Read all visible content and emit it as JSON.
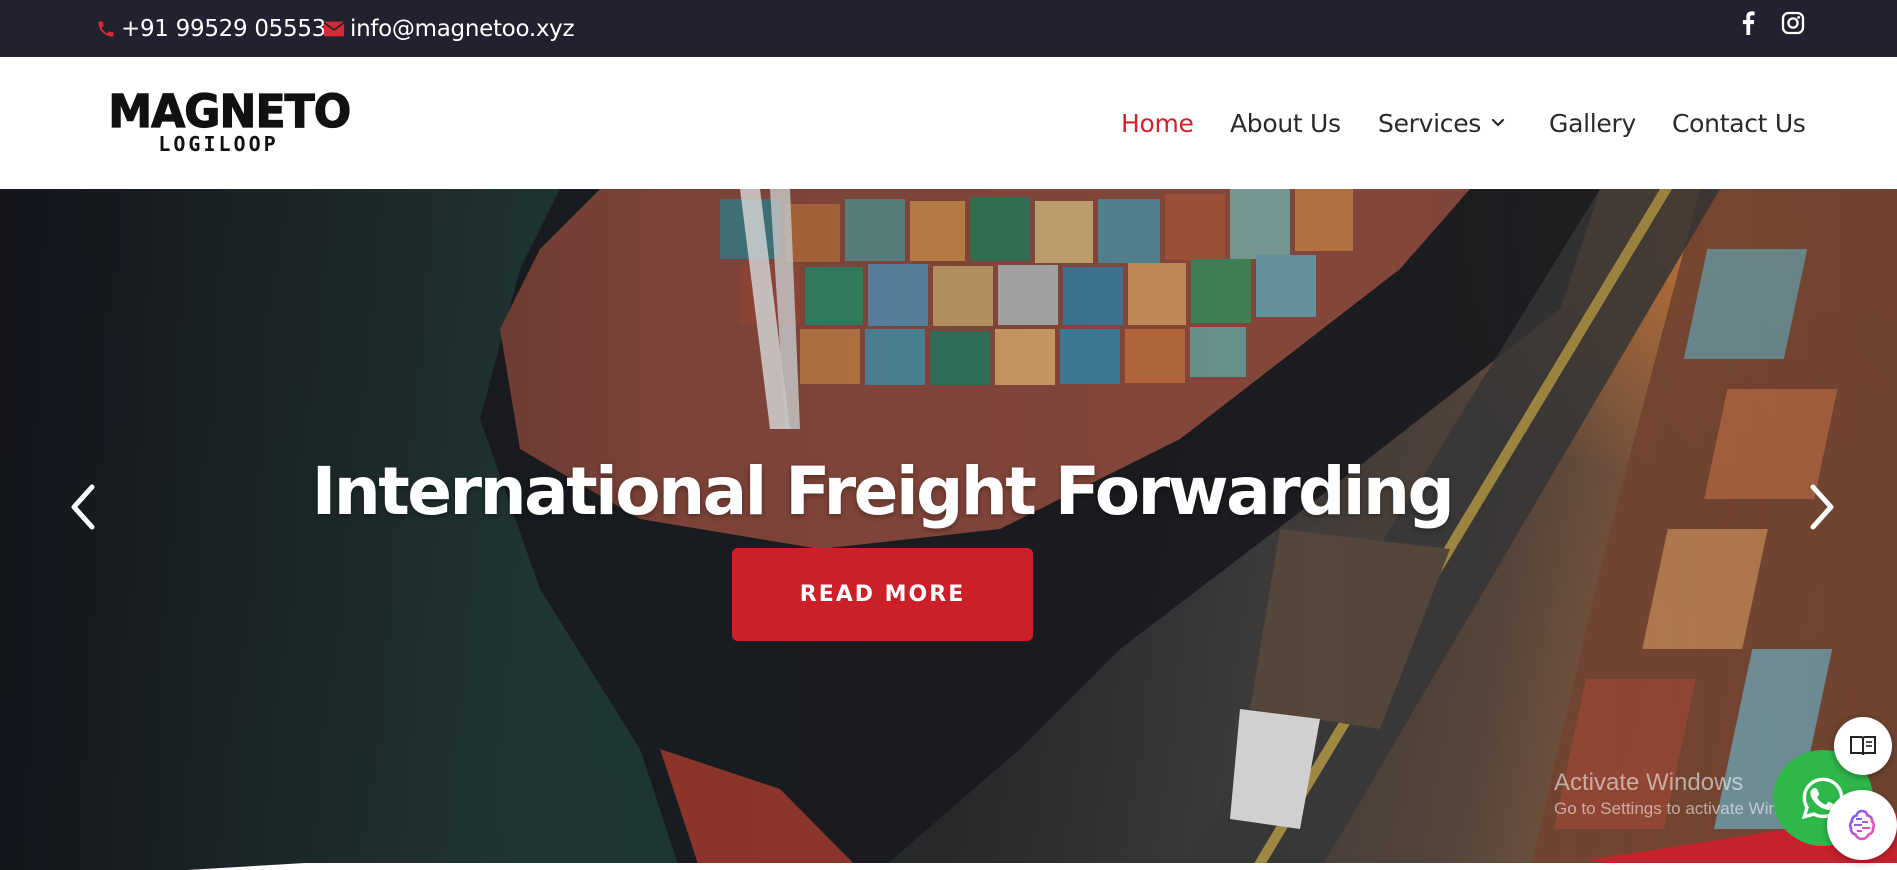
{
  "topbar": {
    "phone": "+91 99529 05553",
    "email": "info@magnetoo.xyz",
    "phone_icon": "phone-icon",
    "email_icon": "envelope-icon",
    "social": [
      "facebook-icon",
      "instagram-icon"
    ]
  },
  "header": {
    "logo": {
      "brand": "MAGNETO",
      "sub": "LOGILOOP"
    },
    "nav": [
      {
        "label": "Home",
        "active": true
      },
      {
        "label": "About Us",
        "active": false
      },
      {
        "label": "Services",
        "active": false,
        "has_dropdown": true
      },
      {
        "label": "Gallery",
        "active": false
      },
      {
        "label": "Contact Us",
        "active": false
      }
    ]
  },
  "hero": {
    "title": "International Freight Forwarding",
    "button": "READ MORE",
    "prev_icon": "chevron-left-icon",
    "next_icon": "chevron-right-icon"
  },
  "watermark": {
    "line1": "Activate Windows",
    "line2": "Go to Settings to activate Windows."
  },
  "widgets": [
    "reader-icon",
    "whatsapp-icon",
    "ai-assistant-icon"
  ],
  "colors": {
    "accent": "#cc1f27",
    "topbar_bg": "#22212f",
    "active_nav": "#d0232d",
    "whatsapp": "#2fb84a"
  }
}
